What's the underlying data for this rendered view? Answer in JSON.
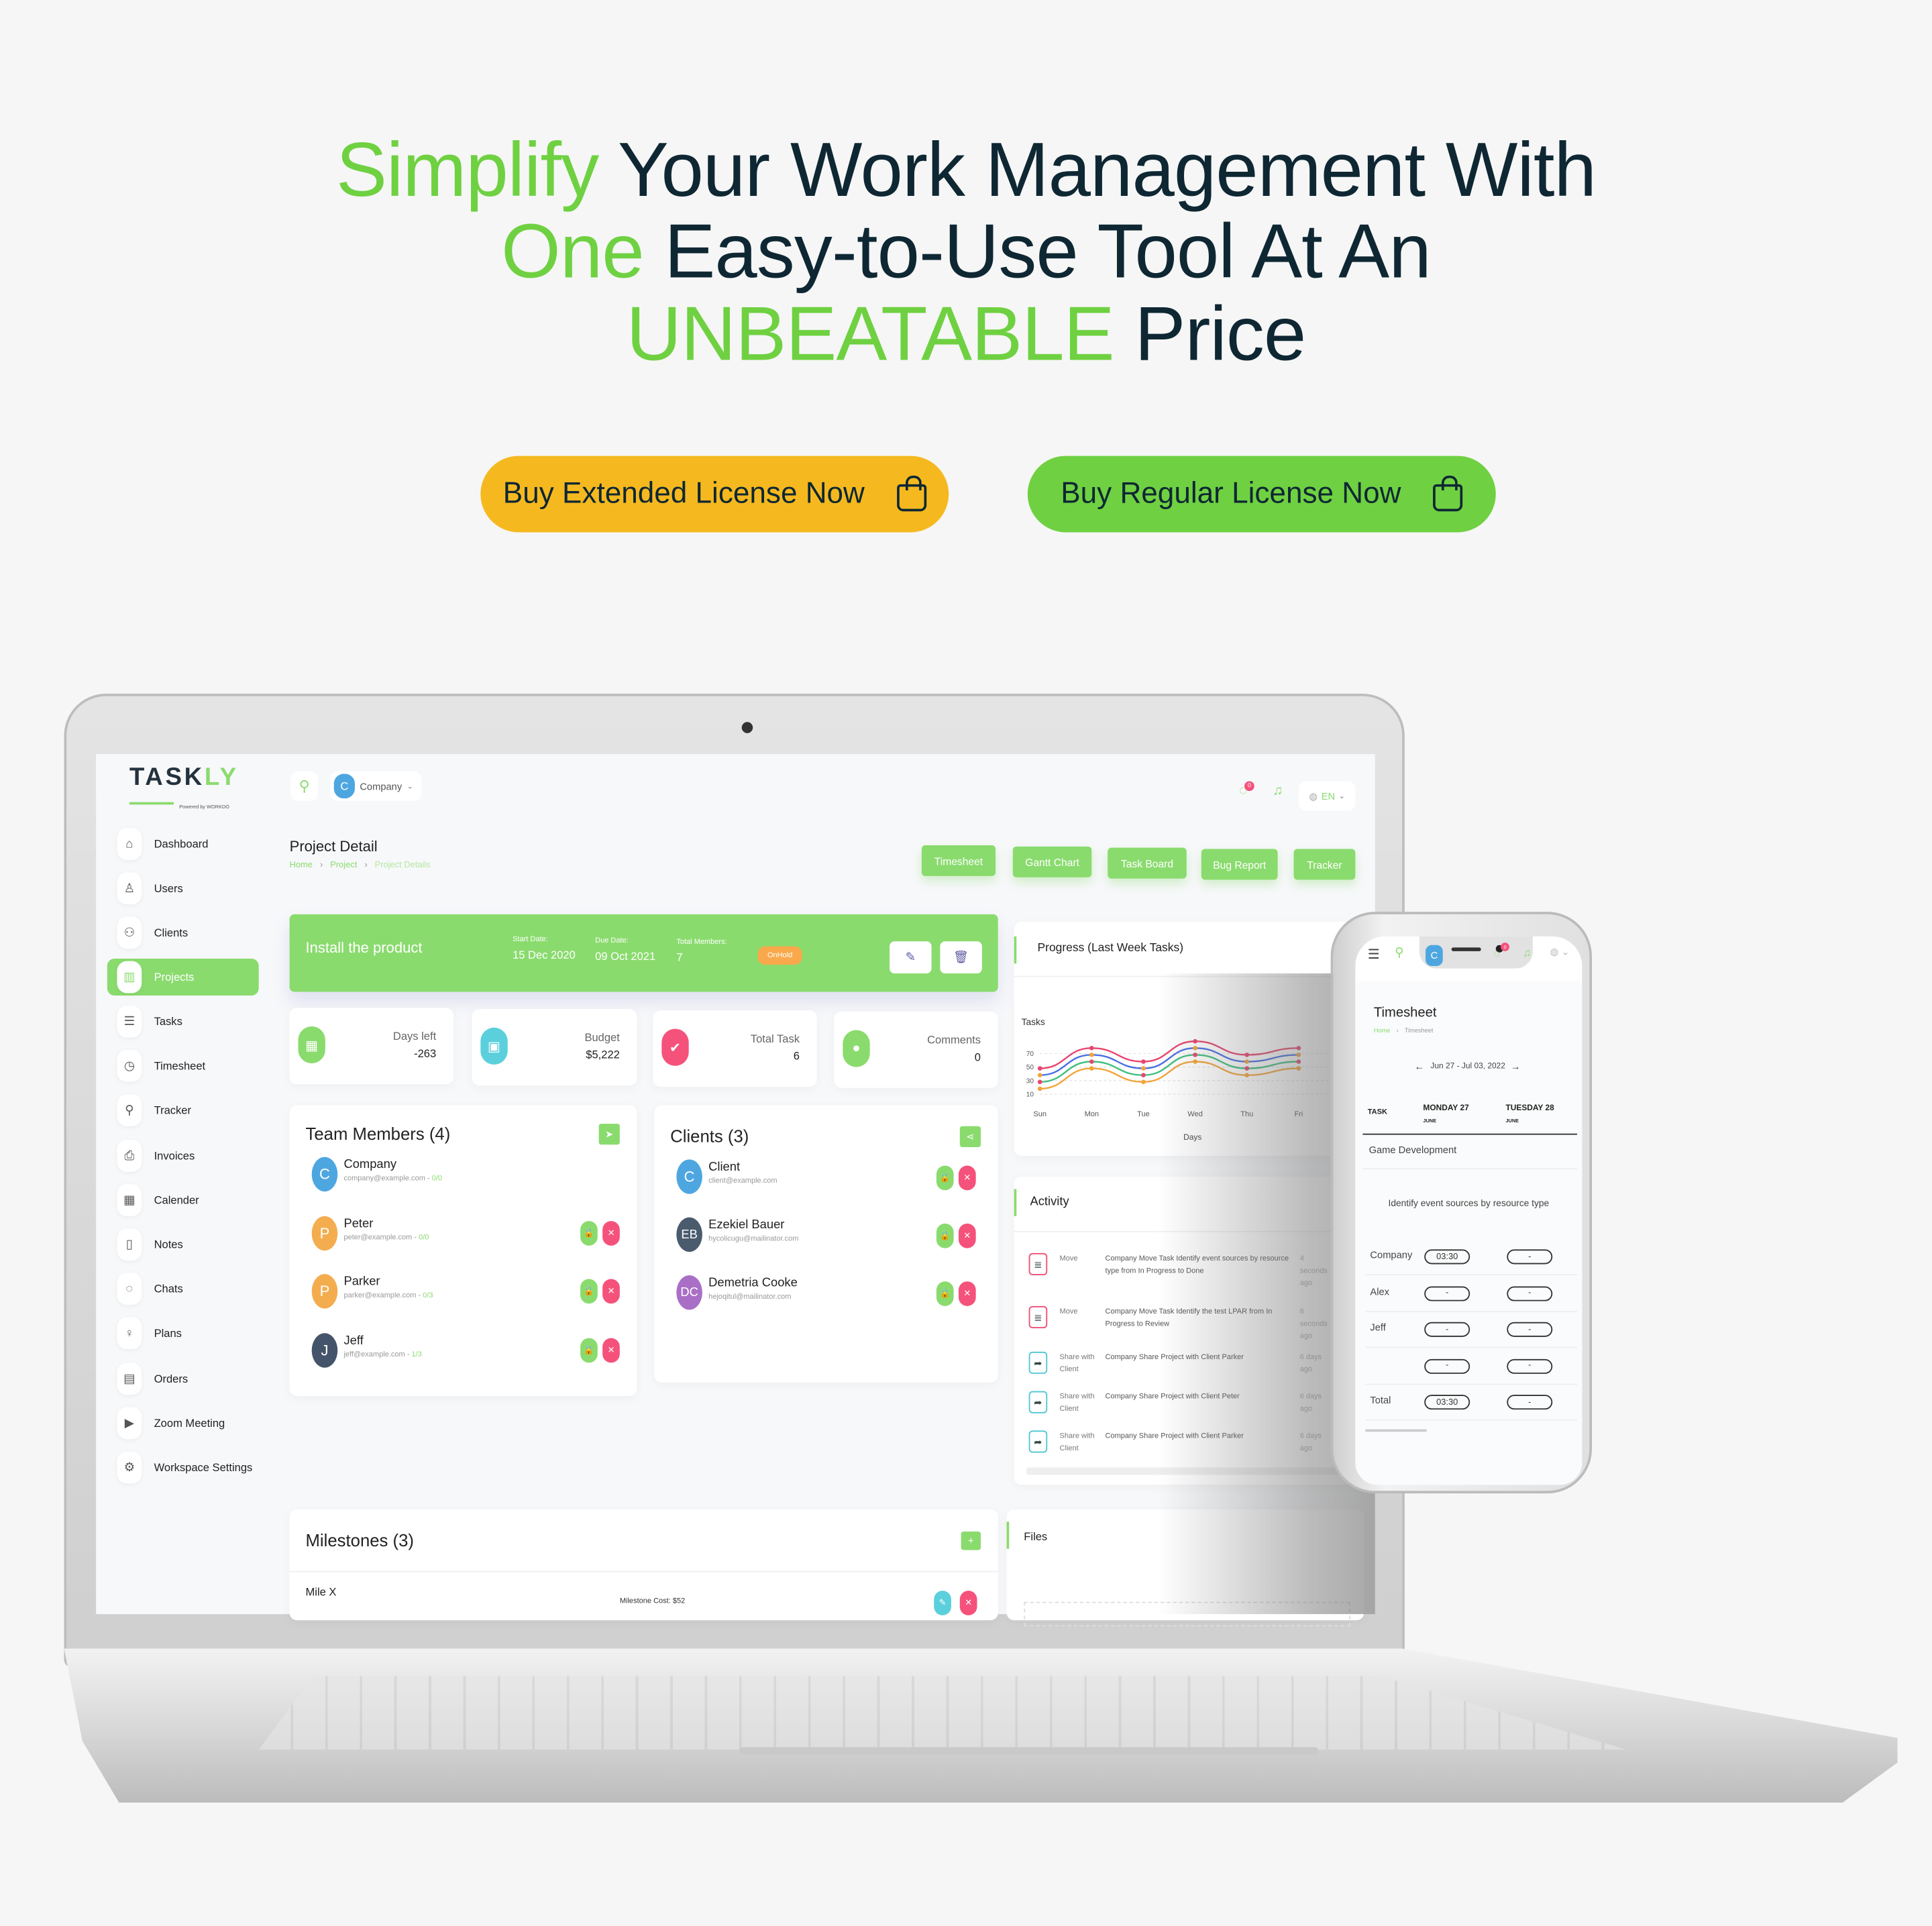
{
  "hero": {
    "line1": {
      "accent": "Simplify",
      "rest": " Your Work Management With"
    },
    "line2": {
      "accent": "One",
      "rest": " Easy-to-Use Tool At An"
    },
    "line3": {
      "accent": "UNBEATABLE",
      "rest": " Price"
    },
    "accent_color": "#6fd141",
    "text_color": "#0e2733"
  },
  "cta": {
    "extended": {
      "label": "Buy Extended License Now",
      "color": "#f5b91f",
      "icon": "shopping-bag-icon"
    },
    "regular": {
      "label": "Buy Regular License Now",
      "color": "#6fd141",
      "icon": "shopping-bag-icon"
    }
  },
  "app": {
    "logo": {
      "name": "TASKLY",
      "tagline": "Powered by WORKDO"
    },
    "topbar": {
      "workspace_initial": "C",
      "workspace": "Company",
      "chat_badge": "0",
      "language": "EN"
    },
    "sidebar": [
      {
        "label": "Dashboard",
        "icon": "⌂",
        "name": "home-icon"
      },
      {
        "label": "Users",
        "icon": "♙",
        "name": "user-icon"
      },
      {
        "label": "Clients",
        "icon": "⚇",
        "name": "clients-icon"
      },
      {
        "label": "Projects",
        "icon": "▥",
        "name": "projects-icon",
        "active": true
      },
      {
        "label": "Tasks",
        "icon": "☰",
        "name": "tasks-icon"
      },
      {
        "label": "Timesheet",
        "icon": "◷",
        "name": "clock-icon"
      },
      {
        "label": "Tracker",
        "icon": "⚲",
        "name": "tracker-icon"
      },
      {
        "label": "Invoices",
        "icon": "⎙",
        "name": "printer-icon"
      },
      {
        "label": "Calender",
        "icon": "▦",
        "name": "calendar-icon"
      },
      {
        "label": "Notes",
        "icon": "▯",
        "name": "notes-icon"
      },
      {
        "label": "Chats",
        "icon": "◌",
        "name": "chat-icon"
      },
      {
        "label": "Plans",
        "icon": "♀",
        "name": "trophy-icon"
      },
      {
        "label": "Orders",
        "icon": "▤",
        "name": "orders-icon"
      },
      {
        "label": "Zoom Meeting",
        "icon": "▶",
        "name": "video-icon"
      },
      {
        "label": "Workspace Settings",
        "icon": "⚙",
        "name": "gear-icon"
      }
    ],
    "page": {
      "title": "Project Detail",
      "breadcrumb": [
        "Home",
        "Project",
        "Project Details"
      ],
      "actions": [
        "Timesheet",
        "Gantt Chart",
        "Task Board",
        "Bug Report",
        "Tracker"
      ]
    },
    "project": {
      "name": "Install the product",
      "start_label": "Start Date:",
      "start": "15 Dec 2020",
      "due_label": "Due Date:",
      "due": "09 Oct 2021",
      "members_label": "Total Members:",
      "members": "7",
      "status": "OnHold"
    },
    "stats": [
      {
        "label": "Days left",
        "value": "-263",
        "color": "#8adb6e",
        "icon": "calendar-icon",
        "glyph": "▦"
      },
      {
        "label": "Budget",
        "value": "$5,222",
        "color": "#5bd0dc",
        "icon": "money-icon",
        "glyph": "▣"
      },
      {
        "label": "Total Task",
        "value": "6",
        "color": "#f5527b",
        "icon": "double-check-icon",
        "glyph": "✔"
      },
      {
        "label": "Comments",
        "value": "0",
        "color": "#8adb6e",
        "icon": "comments-icon",
        "glyph": "●"
      }
    ],
    "team": {
      "title": "Team Members (4)",
      "members": [
        {
          "initial": "C",
          "name": "Company",
          "email": "company@example.com",
          "tasks": "0/0",
          "color": "#4ea6e0",
          "actions": false
        },
        {
          "initial": "P",
          "name": "Peter",
          "email": "peter@example.com",
          "tasks": "0/0",
          "color": "#f4ad4e",
          "actions": true
        },
        {
          "initial": "P",
          "name": "Parker",
          "email": "parker@example.com",
          "tasks": "0/3",
          "color": "#f4ad4e",
          "actions": true
        },
        {
          "initial": "J",
          "name": "Jeff",
          "email": "jeff@example.com",
          "tasks": "1/3",
          "color": "#44546a",
          "actions": true
        }
      ]
    },
    "clients": {
      "title": "Clients (3)",
      "items": [
        {
          "initial": "C",
          "name": "Client",
          "email": "client@example.com",
          "color": "#4ea6e0"
        },
        {
          "initial": "EB",
          "name": "Ezekiel Bauer",
          "email": "hycolicugu@mailinator.com",
          "color": "#4a5b6e"
        },
        {
          "initial": "DC",
          "name": "Demetria Cooke",
          "email": "hejoqitul@mailinator.com",
          "color": "#a96fc6"
        }
      ]
    },
    "progress": {
      "title": "Progress (Last Week Tasks)"
    },
    "chart_data": {
      "type": "line",
      "title": "Progress (Last Week Tasks)",
      "xlabel": "Days",
      "ylabel": "Tasks",
      "categories": [
        "Sun",
        "Mon",
        "Tue",
        "Wed",
        "Thu",
        "Fri"
      ],
      "yticks": [
        10,
        30,
        50,
        70
      ],
      "ylim": [
        10,
        70
      ],
      "grid": true,
      "smooth": true,
      "series": [
        {
          "color": "#e9456f",
          "values": [
            48,
            78,
            58,
            88,
            68,
            78
          ]
        },
        {
          "color": "#4a6fe3",
          "values": [
            38,
            68,
            48,
            78,
            58,
            68
          ]
        },
        {
          "color": "#3fbf7f",
          "values": [
            28,
            58,
            38,
            68,
            48,
            58
          ]
        },
        {
          "color": "#f2a43a",
          "values": [
            18,
            48,
            28,
            58,
            38,
            48
          ]
        }
      ]
    },
    "activity": {
      "title": "Activity",
      "items": [
        {
          "type": "Move",
          "desc": "Company Move Task Identify event sources by resource type from In Progress to Done",
          "time": "4 seconds ago",
          "kind": "move"
        },
        {
          "type": "Move",
          "desc": "Company Move Task Identify the test LPAR from In Progress to Review",
          "time": "6 seconds ago",
          "kind": "move"
        },
        {
          "type": "Share with Client",
          "desc": "Company Share Project with Client Parker",
          "time": "6 days ago",
          "kind": "share"
        },
        {
          "type": "Share with Client",
          "desc": "Company Share Project with Client Peter",
          "time": "6 days ago",
          "kind": "share"
        },
        {
          "type": "Share with Client",
          "desc": "Company Share Project with Client Parker",
          "time": "6 days ago",
          "kind": "share"
        }
      ]
    },
    "milestones": {
      "title": "Milestones (3)",
      "first": {
        "name": "Mile X",
        "cost": "Milestone Cost: $52"
      }
    },
    "files": {
      "title": "Files"
    }
  },
  "phone": {
    "workspace_initial": "C",
    "chat_badge": "0",
    "title": "Timesheet",
    "breadcrumb": [
      "Home",
      "Timesheet"
    ],
    "range": "Jun 27 - Jul 03, 2022",
    "columns": [
      {
        "label": "TASK",
        "sub": ""
      },
      {
        "label": "MONDAY 27",
        "sub": "JUNE"
      },
      {
        "label": "TUESDAY 28",
        "sub": "JUNE"
      }
    ],
    "project": "Game Development",
    "task": "Identify event sources by resource type",
    "rows": [
      {
        "label": "Company",
        "mon": "03:30",
        "tue": "-"
      },
      {
        "label": "Alex",
        "mon": "-",
        "tue": "-"
      },
      {
        "label": "Jeff",
        "mon": "-",
        "tue": "-"
      },
      {
        "label": "",
        "mon": "-",
        "tue": "-"
      },
      {
        "label": "Total",
        "mon": "03:30",
        "tue": "-"
      }
    ]
  }
}
